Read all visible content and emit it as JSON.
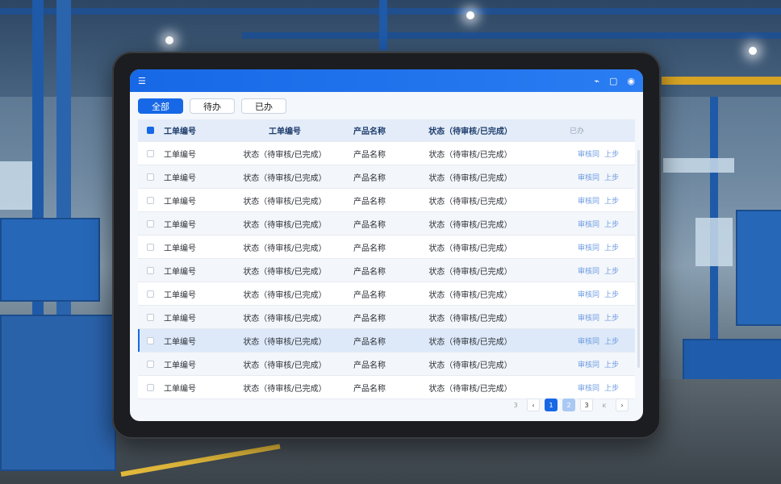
{
  "tabs": [
    {
      "label": "全部",
      "active": true
    },
    {
      "label": "待办",
      "active": false
    },
    {
      "label": "已办",
      "active": false
    }
  ],
  "table": {
    "headers": [
      "工单编号",
      "工单编号",
      "产品名称",
      "状态（待审核/已完成）",
      "已办"
    ],
    "rows": [
      {
        "id": "工单编号",
        "status2": "状态（待审核/已完成）",
        "product": "产品名称",
        "status": "状态（待审核/已完成）",
        "action1": "审核同",
        "action2": "上步"
      },
      {
        "id": "工单编号",
        "status2": "状态（待审核/已完成）",
        "product": "产品名称",
        "status": "状态（待审核/已完成）",
        "action1": "审核同",
        "action2": "上步"
      },
      {
        "id": "工单编号",
        "status2": "状态（待审核/已完成）",
        "product": "产品名称",
        "status": "状态（待审核/已完成）",
        "action1": "审核同",
        "action2": "上步"
      },
      {
        "id": "工单编号",
        "status2": "状态（待审核/已完成）",
        "product": "产品名称",
        "status": "状态（待审核/已完成）",
        "action1": "审核同",
        "action2": "上步"
      },
      {
        "id": "工单编号",
        "status2": "状态（待审核/已完成）",
        "product": "产品名称",
        "status": "状态（待审核/已完成）",
        "action1": "审核同",
        "action2": "上步"
      },
      {
        "id": "工单编号",
        "status2": "状态（待审核/已完成）",
        "product": "产品名称",
        "status": "状态（待审核/已完成）",
        "action1": "审核同",
        "action2": "上步"
      },
      {
        "id": "工单编号",
        "status2": "状态（待审核/已完成）",
        "product": "产品名称",
        "status": "状态（待审核/已完成）",
        "action1": "审核同",
        "action2": "上步"
      },
      {
        "id": "工单编号",
        "status2": "状态（待审核/已完成）",
        "product": "产品名称",
        "status": "状态（待审核/已完成）",
        "action1": "审核同",
        "action2": "上步"
      },
      {
        "id": "工单编号",
        "status2": "状态（待审核/已完成）",
        "product": "产品名称",
        "status": "状态（待审核/已完成）",
        "action1": "审核同",
        "action2": "上步"
      },
      {
        "id": "工单编号",
        "status2": "状态（待审核/已完成）",
        "product": "产品名称",
        "status": "状态（待审核/已完成）",
        "action1": "审核同",
        "action2": "上步"
      },
      {
        "id": "工单编号",
        "status2": "状态（待审核/已完成）",
        "product": "产品名称",
        "status": "状态（待审核/已完成）",
        "action1": "审核同",
        "action2": "上步"
      }
    ]
  },
  "pagination": {
    "first": "3",
    "prev": "‹",
    "pages": [
      "1",
      "2",
      "3"
    ],
    "ellipsis": "ĸ",
    "next": "›"
  },
  "icons": {
    "menu": "menu-icon",
    "minimize": "minimize-icon",
    "window": "window-icon",
    "user": "user-icon"
  },
  "colors": {
    "accent": "#1768e6",
    "header_bg": "#e3ecf8",
    "link": "#6c9be0"
  }
}
